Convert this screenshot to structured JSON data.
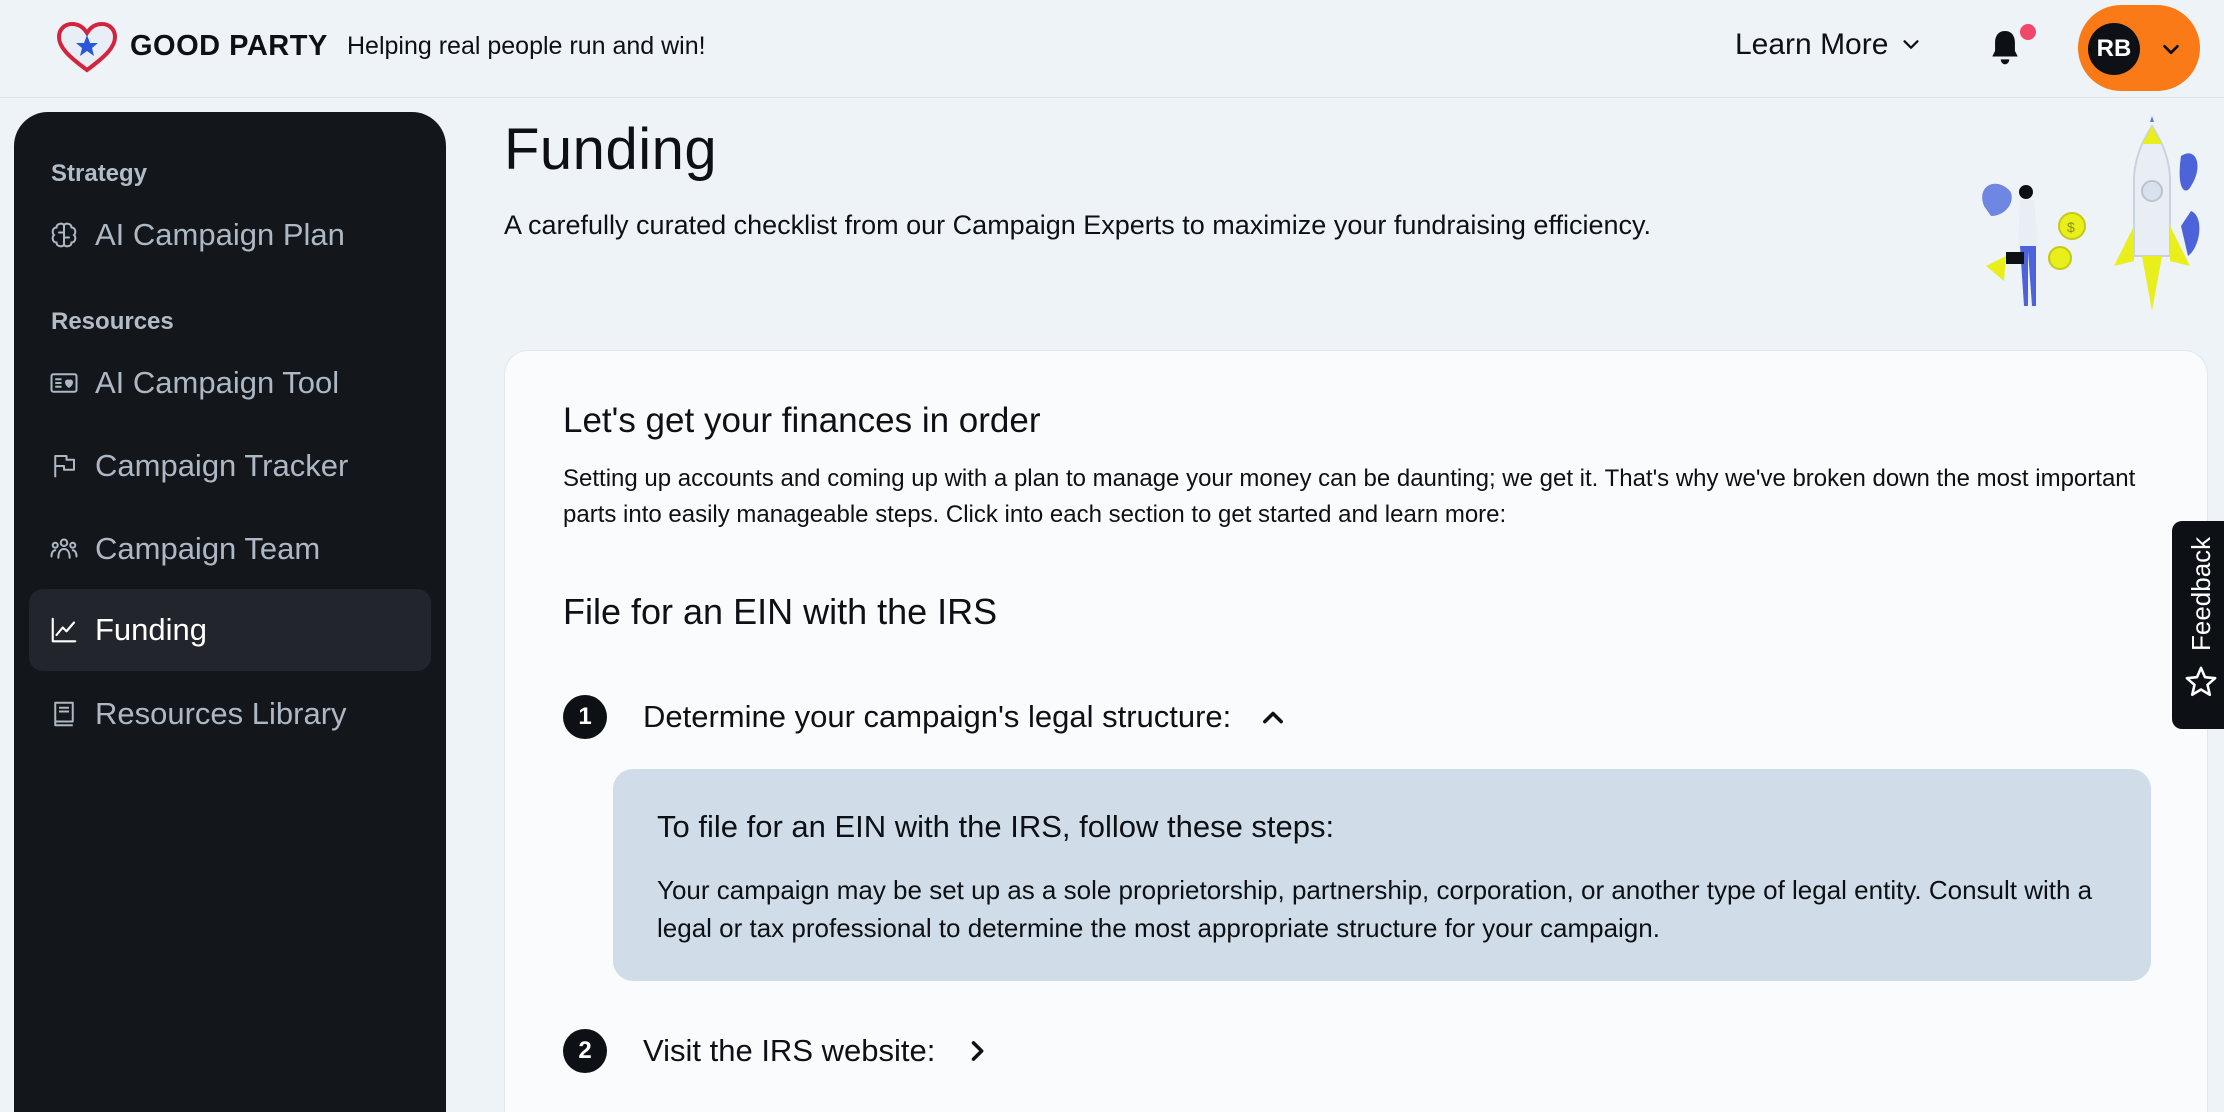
{
  "header": {
    "brand": "GOOD PARTY",
    "tagline": "Helping real people run and win!",
    "learn_more": "Learn More",
    "user_initials": "RB"
  },
  "sidebar": {
    "sections": [
      {
        "label": "Strategy",
        "items": [
          {
            "label": "AI Campaign Plan",
            "icon": "brain-icon"
          }
        ]
      },
      {
        "label": "Resources",
        "items": [
          {
            "label": "AI Campaign Tool",
            "icon": "id-card-icon"
          },
          {
            "label": "Campaign Tracker",
            "icon": "flag-icon"
          },
          {
            "label": "Campaign Team",
            "icon": "team-icon"
          },
          {
            "label": "Funding",
            "icon": "chart-line-icon",
            "active": true
          },
          {
            "label": "Resources Library",
            "icon": "book-icon"
          }
        ]
      }
    ]
  },
  "main": {
    "title": "Funding",
    "subtitle": "A carefully curated checklist from our Campaign Experts to maximize your fundraising efficiency.",
    "card": {
      "heading": "Let's get your finances in order",
      "intro": "Setting up accounts and coming up with a plan to manage your money can be daunting; we get it. That's why we've broken down the most important parts into easily manageable steps. Click into each section to get started and learn more:",
      "section_title": "File for an EIN with the IRS",
      "steps": [
        {
          "number": "1",
          "title": "Determine your campaign's legal structure:",
          "expanded": true,
          "panel_heading": "To file for an EIN with the IRS, follow these steps:",
          "panel_body": "Your campaign may be set up as a sole proprietorship, partnership, corporation, or another type of legal entity. Consult with a legal or tax professional to determine the most appropriate structure for your campaign."
        },
        {
          "number": "2",
          "title": "Visit the IRS website:",
          "expanded": false
        }
      ]
    }
  },
  "feedback": {
    "label": "Feedback"
  },
  "colors": {
    "accent": "#fb7a18",
    "notification_dot": "#f0476b",
    "sidebar_bg": "#13171c",
    "panel_bg": "#d0dce8"
  }
}
